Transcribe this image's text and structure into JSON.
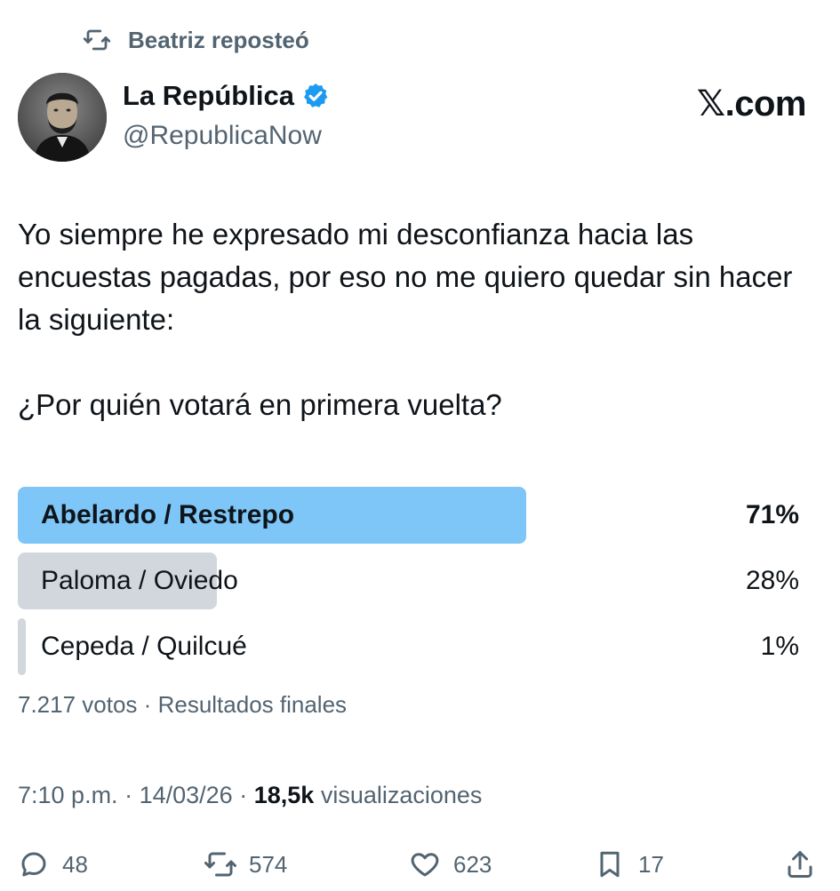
{
  "repost": {
    "icon": "repost-icon",
    "text": "Beatriz reposteó"
  },
  "author": {
    "name": "La República",
    "handle": "@RepublicaNow",
    "verified_color": "#1d9bf0"
  },
  "brand": {
    "x": "𝕏",
    "domain": ".com"
  },
  "tweet": {
    "body": "Yo siempre he expresado mi desconfianza hacia las encuestas pagadas, por eso no me quiero quedar sin hacer la siguiente:",
    "question": "¿Por quién votará en primera vuelta?"
  },
  "poll": {
    "options": [
      {
        "label": "Abelardo / Restrepo",
        "percent": "71%",
        "value": 71,
        "bar_color": "#7ec6f7"
      },
      {
        "label": "Paloma / Oviedo",
        "percent": "28%",
        "value": 28,
        "bar_color": "#d1d7dc"
      },
      {
        "label": "Cepeda / Quilcué",
        "percent": "1%",
        "value": 1,
        "bar_color": "#d1d7dc"
      }
    ],
    "votes": "7.217 votos",
    "status": "Resultados finales"
  },
  "meta": {
    "time": "7:10 p.m.",
    "date": "14/03/26",
    "views_count": "18,5k",
    "views_label": "visualizaciones"
  },
  "actions": {
    "replies": "48",
    "reposts": "574",
    "likes": "623",
    "bookmarks": "17"
  }
}
